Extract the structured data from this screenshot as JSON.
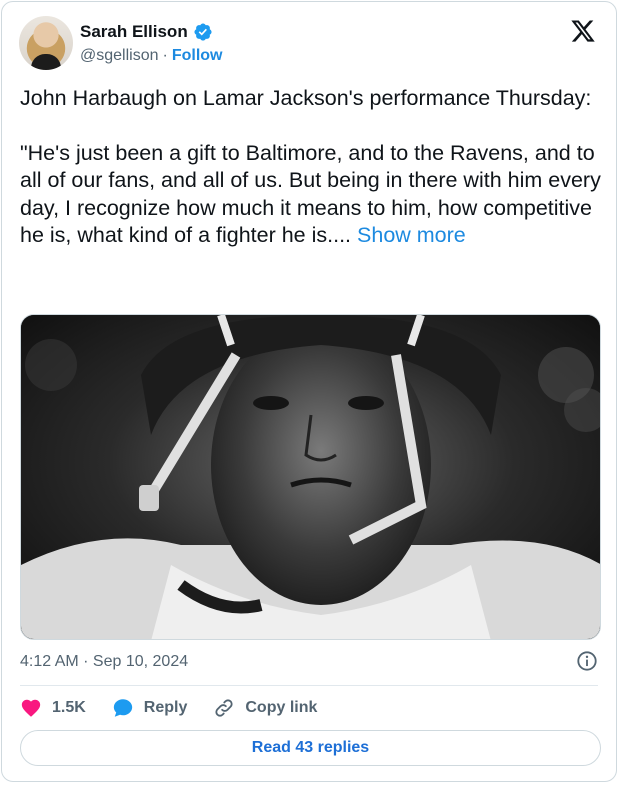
{
  "author": {
    "name": "Sarah Ellison",
    "handle": "@sgellison",
    "separator": "·",
    "follow_label": "Follow"
  },
  "tweet": {
    "text": "John Harbaugh on Lamar Jackson's performance Thursday:\n\n\"He's just been a gift to Baltimore, and to the Ravens, and to all of our fans, and all of us. But being in there with him every day, I recognize how much it means to him, how competitive he is, what kind of a fighter he is.... ",
    "show_more_label": "Show more"
  },
  "meta": {
    "timestamp": "4:12 AM · Sep 10, 2024"
  },
  "actions": {
    "like_count": "1.5K",
    "reply_label": "Reply",
    "copy_link_label": "Copy link"
  },
  "footer": {
    "read_replies_label": "Read 43 replies"
  },
  "icons": {
    "brand": "x-logo-icon",
    "verified": "verified-badge-icon",
    "like": "heart-icon",
    "reply": "speech-bubble-icon",
    "copy": "link-icon",
    "info": "info-icon"
  },
  "colors": {
    "accent": "#1d9bf0",
    "like": "#f91880",
    "text": "#0f1419",
    "muted": "#536471"
  }
}
